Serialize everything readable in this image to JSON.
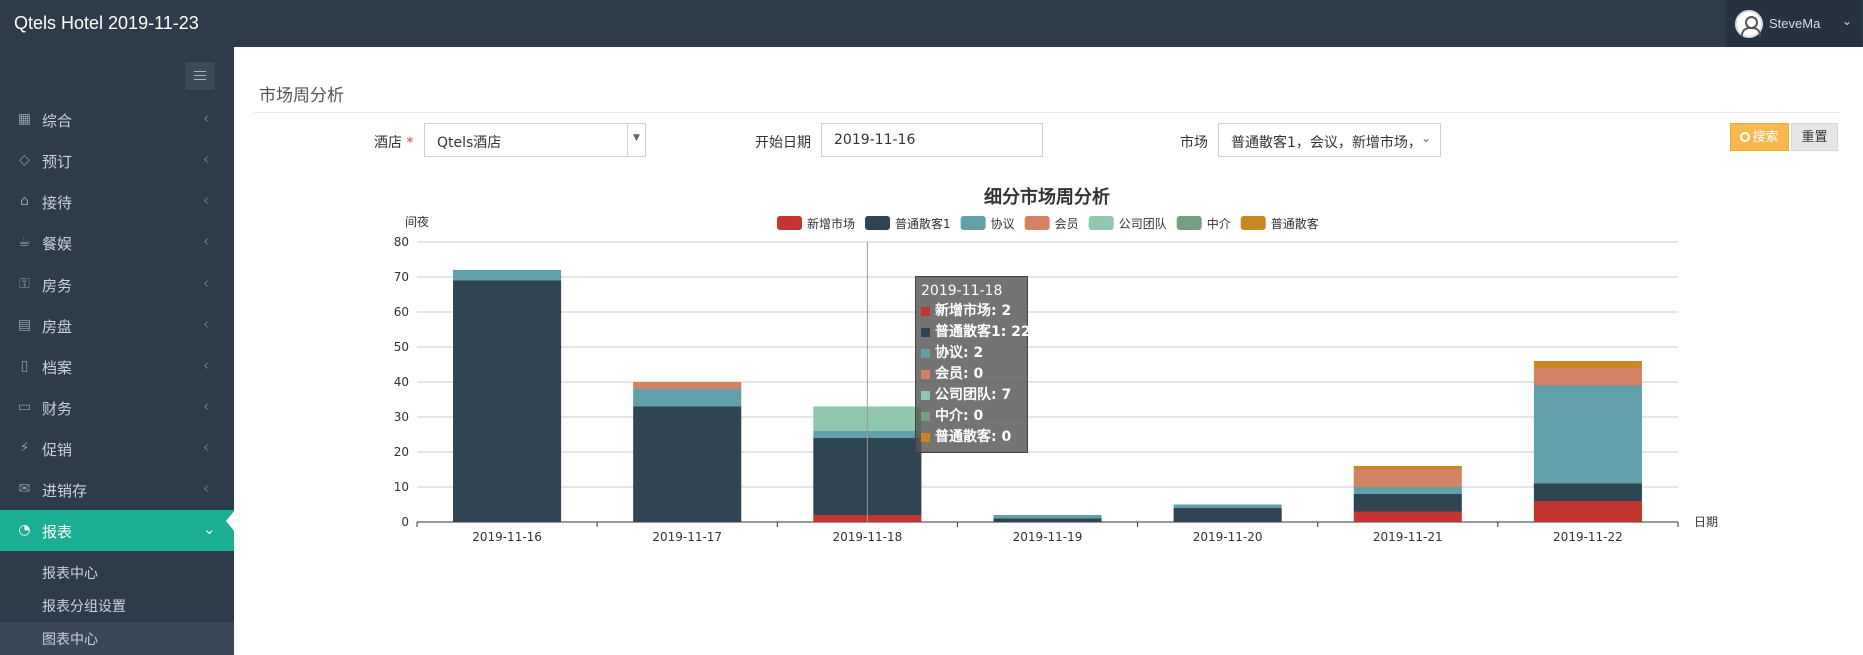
{
  "app": {
    "title": "Qtels Hotel 2019-11-23"
  },
  "user": {
    "name": "SteveMa",
    "caret": "⌄"
  },
  "sidebar": {
    "items": [
      {
        "label": "综合",
        "icon": "grid-icon",
        "glyph": "▦",
        "arrow": "‹"
      },
      {
        "label": "预订",
        "icon": "tag-icon",
        "glyph": "◇",
        "arrow": "‹"
      },
      {
        "label": "接待",
        "icon": "home-icon",
        "glyph": "⌂",
        "arrow": "‹"
      },
      {
        "label": "餐娱",
        "icon": "cup-icon",
        "glyph": "☕",
        "arrow": "‹"
      },
      {
        "label": "房务",
        "icon": "key-icon",
        "glyph": "⚿",
        "arrow": "‹"
      },
      {
        "label": "房盘",
        "icon": "calendar-icon",
        "glyph": "▤",
        "arrow": "‹"
      },
      {
        "label": "档案",
        "icon": "book-icon",
        "glyph": "▯",
        "arrow": "‹"
      },
      {
        "label": "财务",
        "icon": "folder-icon",
        "glyph": "▭",
        "arrow": "‹"
      },
      {
        "label": "促销",
        "icon": "lightning-icon",
        "glyph": "⚡",
        "arrow": "‹"
      },
      {
        "label": "进销存",
        "icon": "envelope-icon",
        "glyph": "✉",
        "arrow": "‹"
      },
      {
        "label": "报表",
        "icon": "pie-chart-icon",
        "glyph": "◔",
        "arrow": "⌄",
        "active": true
      }
    ],
    "subitems": [
      {
        "label": "报表中心"
      },
      {
        "label": "报表分组设置"
      },
      {
        "label": "图表中心",
        "current": true
      }
    ]
  },
  "page": {
    "title": "市场周分析"
  },
  "filters": {
    "hotel_label": "酒店",
    "required_mark": "*",
    "hotel_value": "Qtels酒店",
    "hotel_arrow": "▼",
    "start_date_label": "开始日期",
    "start_date_value": "2019-11-16",
    "market_label": "市场",
    "market_value": "普通散客1，会议，新增市场，…",
    "market_arrow": "⌄",
    "search_label": "搜索",
    "reset_label": "重置"
  },
  "colors": {
    "accent": "#1cae94",
    "header": "#2e3b4b",
    "search": "#f7b84e"
  },
  "chart_data": {
    "type": "bar",
    "stacked": true,
    "title": "细分市场周分析",
    "ylabel": "间夜",
    "xlabel": "日期",
    "ylim": [
      0,
      80
    ],
    "yticks": [
      0,
      10,
      20,
      30,
      40,
      50,
      60,
      70,
      80
    ],
    "grid": true,
    "legend_position": "top",
    "categories": [
      "2019-11-16",
      "2019-11-17",
      "2019-11-18",
      "2019-11-19",
      "2019-11-20",
      "2019-11-21",
      "2019-11-22"
    ],
    "series": [
      {
        "name": "新增市场",
        "color": "#c23531",
        "values": [
          0,
          0,
          2,
          0,
          0,
          3,
          6
        ]
      },
      {
        "name": "普通散客1",
        "color": "#2f4554",
        "values": [
          69,
          33,
          22,
          1,
          4,
          5,
          5
        ]
      },
      {
        "name": "协议",
        "color": "#61a0a8",
        "values": [
          3,
          5,
          2,
          1,
          1,
          2,
          28
        ]
      },
      {
        "name": "会员",
        "color": "#d48265",
        "values": [
          0,
          2,
          0,
          0,
          0,
          5,
          5
        ]
      },
      {
        "name": "公司团队",
        "color": "#91c7ae",
        "values": [
          0,
          0,
          7,
          0,
          0,
          0,
          0
        ]
      },
      {
        "name": "中介",
        "color": "#749f83",
        "values": [
          0,
          0,
          0,
          0,
          0,
          0,
          0
        ]
      },
      {
        "name": "普通散客",
        "color": "#ca8622",
        "values": [
          0,
          0,
          0,
          0,
          0,
          1,
          2
        ]
      }
    ],
    "tooltip": {
      "date": "2019-11-18",
      "rows": [
        {
          "text": "新增市场: 2",
          "color": "#c23531"
        },
        {
          "text": "普通散客1: 22",
          "color": "#2f4554"
        },
        {
          "text": "协议: 2",
          "color": "#61a0a8"
        },
        {
          "text": "会员: 0",
          "color": "#d48265"
        },
        {
          "text": "公司团队: 7",
          "color": "#91c7ae"
        },
        {
          "text": "中介: 0",
          "color": "#749f83"
        },
        {
          "text": "普通散客: 0",
          "color": "#ca8622"
        }
      ]
    }
  }
}
